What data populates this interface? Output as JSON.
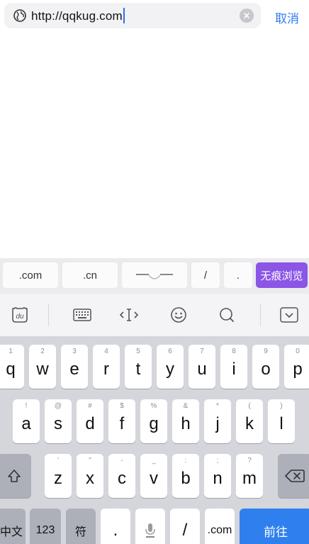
{
  "url_bar": {
    "url": "http://qqkug.com",
    "cancel_label": "取消"
  },
  "quick_bar": {
    "com": ".com",
    "cn": ".cn",
    "slash": "/",
    "dot": ".",
    "incognito": "无痕浏览"
  },
  "toolbar": {
    "icons": [
      "ime-logo-icon",
      "keyboard-icon",
      "cursor-move-icon",
      "emoji-icon",
      "search-icon",
      "collapse-keyboard-icon"
    ]
  },
  "keyboard": {
    "row1": [
      {
        "hint": "1",
        "ch": "q"
      },
      {
        "hint": "2",
        "ch": "w"
      },
      {
        "hint": "3",
        "ch": "e"
      },
      {
        "hint": "4",
        "ch": "r"
      },
      {
        "hint": "5",
        "ch": "t"
      },
      {
        "hint": "6",
        "ch": "y"
      },
      {
        "hint": "7",
        "ch": "u"
      },
      {
        "hint": "8",
        "ch": "i"
      },
      {
        "hint": "9",
        "ch": "o"
      },
      {
        "hint": "0",
        "ch": "p"
      }
    ],
    "row2": [
      {
        "hint": "!",
        "ch": "a"
      },
      {
        "hint": "@",
        "ch": "s"
      },
      {
        "hint": "#",
        "ch": "d"
      },
      {
        "hint": "$",
        "ch": "f"
      },
      {
        "hint": "%",
        "ch": "g"
      },
      {
        "hint": "&",
        "ch": "h"
      },
      {
        "hint": "*",
        "ch": "j"
      },
      {
        "hint": "(",
        "ch": "k"
      },
      {
        "hint": ")",
        "ch": "l"
      }
    ],
    "row3": [
      {
        "hint": "'",
        "ch": "z"
      },
      {
        "hint": "\"",
        "ch": "x"
      },
      {
        "hint": "-",
        "ch": "c"
      },
      {
        "hint": "_",
        "ch": "v"
      },
      {
        "hint": ":",
        "ch": "b"
      },
      {
        "hint": ";",
        "ch": "n"
      },
      {
        "hint": "?",
        "ch": "m"
      }
    ],
    "bottom": {
      "chinese": "中文",
      "numbers": "123",
      "symbols": "符",
      "dot": ".",
      "slash": "/",
      "com": ".com",
      "go": "前往"
    }
  }
}
